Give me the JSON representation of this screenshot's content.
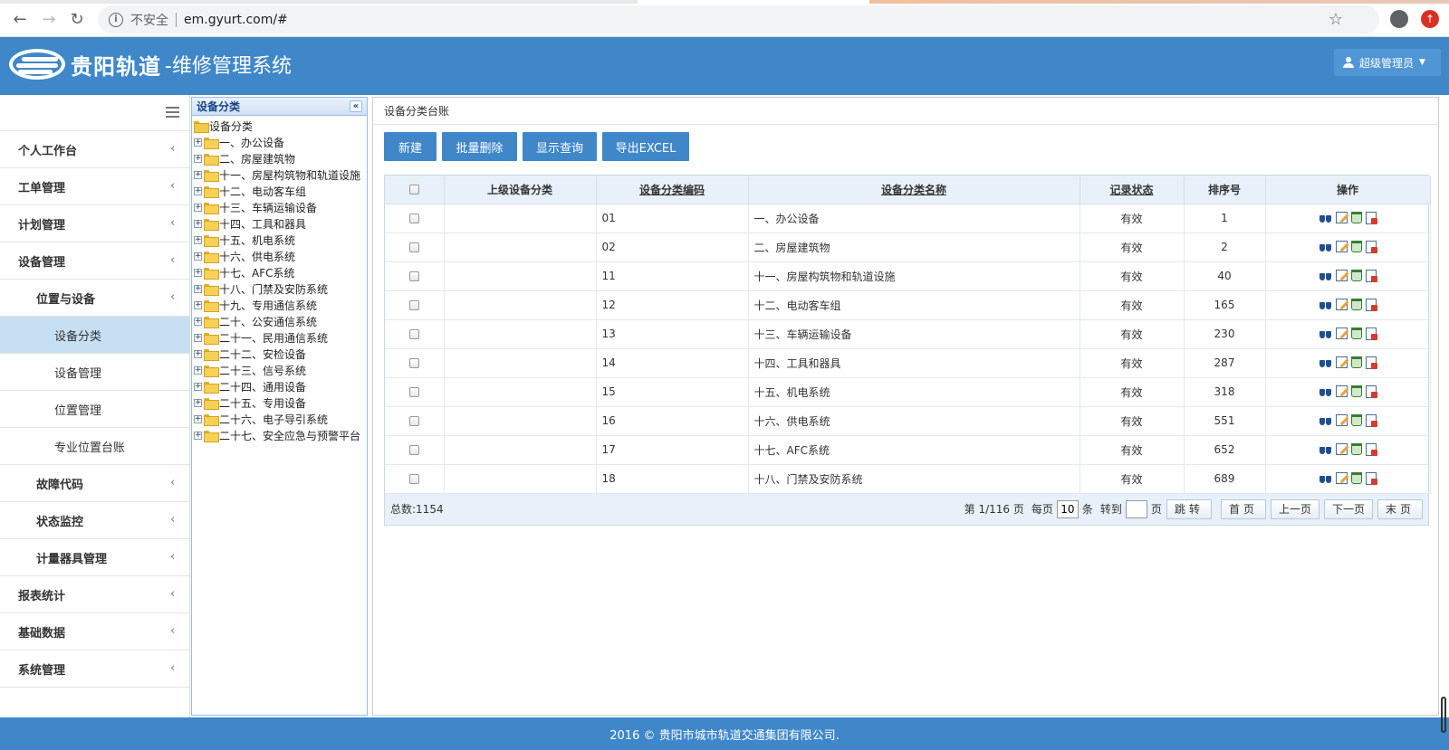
{
  "browser": {
    "security_label": "不安全",
    "url": "em.gyurt.com/#"
  },
  "header": {
    "brand": "贵阳轨道",
    "system_title": "-维修管理系统",
    "user": "超级管理员"
  },
  "sidebar": {
    "items": [
      {
        "label": "个人工作台",
        "level": 1,
        "chevron": true
      },
      {
        "label": "工单管理",
        "level": 1,
        "chevron": true
      },
      {
        "label": "计划管理",
        "level": 1,
        "chevron": true
      },
      {
        "label": "设备管理",
        "level": 1,
        "chevron": true
      },
      {
        "label": "位置与设备",
        "level": 2,
        "chevron": true
      },
      {
        "label": "设备分类",
        "level": 3,
        "chevron": false,
        "active": true
      },
      {
        "label": "设备管理",
        "level": 3,
        "chevron": false
      },
      {
        "label": "位置管理",
        "level": 3,
        "chevron": false
      },
      {
        "label": "专业位置台账",
        "level": 3,
        "chevron": false
      },
      {
        "label": "故障代码",
        "level": 2,
        "chevron": true
      },
      {
        "label": "状态监控",
        "level": 2,
        "chevron": true
      },
      {
        "label": "计量器具管理",
        "level": 2,
        "chevron": true
      },
      {
        "label": "报表统计",
        "level": 1,
        "chevron": true
      },
      {
        "label": "基础数据",
        "level": 1,
        "chevron": true
      },
      {
        "label": "系统管理",
        "level": 1,
        "chevron": true
      }
    ]
  },
  "tree": {
    "title": "设备分类",
    "root": "设备分类",
    "nodes": [
      "一、办公设备",
      "二、房屋建筑物",
      "十一、房屋构筑物和轨道设施",
      "十二、电动客车组",
      "十三、车辆运输设备",
      "十四、工具和器具",
      "十五、机电系统",
      "十六、供电系统",
      "十七、AFC系统",
      "十八、门禁及安防系统",
      "十九、专用通信系统",
      "二十、公安通信系统",
      "二十一、民用通信系统",
      "二十二、安检设备",
      "二十三、信号系统",
      "二十四、通用设备",
      "二十五、专用设备",
      "二十六、电子导引系统",
      "二十七、安全应急与预警平台"
    ]
  },
  "main": {
    "breadcrumb": "设备分类台账",
    "toolbar": [
      "新建",
      "批量删除",
      "显示查询",
      "导出EXCEL"
    ],
    "columns": [
      "",
      "上级设备分类",
      "设备分类编码",
      "设备分类名称",
      "记录状态",
      "排序号",
      "操作"
    ],
    "rows": [
      {
        "parent": "",
        "code": "01",
        "name": "一、办公设备",
        "status": "有效",
        "order": "1"
      },
      {
        "parent": "",
        "code": "02",
        "name": "二、房屋建筑物",
        "status": "有效",
        "order": "2"
      },
      {
        "parent": "",
        "code": "11",
        "name": "十一、房屋构筑物和轨道设施",
        "status": "有效",
        "order": "40"
      },
      {
        "parent": "",
        "code": "12",
        "name": "十二、电动客车组",
        "status": "有效",
        "order": "165"
      },
      {
        "parent": "",
        "code": "13",
        "name": "十三、车辆运输设备",
        "status": "有效",
        "order": "230"
      },
      {
        "parent": "",
        "code": "14",
        "name": "十四、工具和器具",
        "status": "有效",
        "order": "287"
      },
      {
        "parent": "",
        "code": "15",
        "name": "十五、机电系统",
        "status": "有效",
        "order": "318"
      },
      {
        "parent": "",
        "code": "16",
        "name": "十六、供电系统",
        "status": "有效",
        "order": "551"
      },
      {
        "parent": "",
        "code": "17",
        "name": "十七、AFC系统",
        "status": "有效",
        "order": "652"
      },
      {
        "parent": "",
        "code": "18",
        "name": "十八、门禁及安防系统",
        "status": "有效",
        "order": "689"
      }
    ],
    "pager": {
      "total": "总数:1154",
      "page_info": "第 1/116 页",
      "per_page_label": "每页",
      "per_page_value": "10",
      "per_page_unit": "条",
      "goto_label": "转到",
      "goto_unit": "页",
      "jump": "跳转",
      "first": "首页",
      "prev": "上一页",
      "next": "下一页",
      "last": "末页"
    }
  },
  "footer": "2016 © 贵阳市城市轨道交通集团有限公司."
}
